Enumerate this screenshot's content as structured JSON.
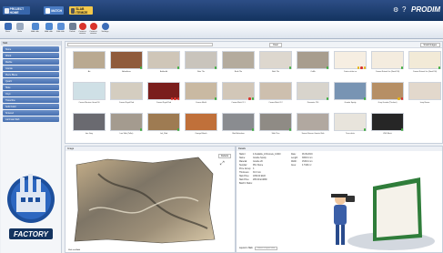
{
  "topbar": {
    "tabs": [
      {
        "label": "PROJECT HOME"
      },
      {
        "label": "MATCH"
      },
      {
        "label": "SLAB ITEMIZE"
      }
    ],
    "brand": "PRODIM",
    "icons": [
      "gear-icon",
      "question-icon"
    ]
  },
  "ribbon": {
    "buttons": [
      "Save",
      "Undo",
      "Add slab",
      "Add slab",
      "Edit slab",
      "Delete",
      "Connect camera",
      "Connect camera",
      "Settings"
    ]
  },
  "sidebar": {
    "header": "Slab",
    "items": [
      "Stone",
      "Wood",
      "Marble",
      "Granite",
      "Pierre Bleue",
      "Quartz",
      "Slate",
      "Onyx",
      "Travertine",
      "Solid Color",
      "Sintered",
      "Laminate Slab"
    ]
  },
  "grid": {
    "search_button": "Clear",
    "view_select": "Small Images",
    "tiles": [
      {
        "label": "Art"
      },
      {
        "label": "Arborifieso"
      },
      {
        "label": "Artifordid"
      },
      {
        "label": "Bats Tile"
      },
      {
        "label": "Bathi Tile"
      },
      {
        "label": "Bath Tile"
      },
      {
        "label": "CaMa"
      },
      {
        "label": "Cortes white ice"
      },
      {
        "label": "Cosmo Natural Ice (Small 90)"
      },
      {
        "label": "Cosmo Natural Ice (Small 90)"
      },
      {
        "label": "Cosmo Marinus Grand 90"
      },
      {
        "label": "Cosmo Royal Red"
      },
      {
        "label": "Cosmo Royal Red"
      },
      {
        "label": "Cosmo Marhl"
      },
      {
        "label": "Cosmo Marhl 1.1"
      },
      {
        "label": "Cosmo Marhl 1.2"
      },
      {
        "label": "Diamante 790"
      },
      {
        "label": "Granite Spotty"
      },
      {
        "label": "Gray Granite (Thickest)"
      },
      {
        "label": "Ivory Brown"
      },
      {
        "label": "Iron Grey"
      },
      {
        "label": "Iron Slab (Toller)"
      },
      {
        "label": "Lak_Slab"
      },
      {
        "label": "Orange Blanch"
      },
      {
        "label": "Slab Belvedere"
      },
      {
        "label": "Slab Tiles"
      },
      {
        "label": "Sunset Breeze Granite Slab"
      },
      {
        "label": "Terra white"
      },
      {
        "label": "ZHS Black"
      }
    ]
  },
  "preview": {
    "header": "Image",
    "button": "Defects",
    "caption": "Slab and Add"
  },
  "details": {
    "header": "Details",
    "rows": [
      {
        "k": "Slabnr:",
        "v": "4-Scalable_Z-Ronnele_13440"
      },
      {
        "k": "Name:",
        "v": "Granite Spotty"
      },
      {
        "k": "Material:",
        "v": "Granite 2K"
      },
      {
        "k": "Supplier:",
        "v": "Plim Stone"
      },
      {
        "k": "Price Group:",
        "v": "3"
      },
      {
        "k": "Thickness:",
        "v": "30.0 mm"
      },
      {
        "k": "Slab Price:",
        "v": "1050.00 EUR"
      },
      {
        "k": "Slab Price:",
        "v": "295.00 EUR/M²"
      },
      {
        "k": "Batch's Slabs:",
        "v": ""
      }
    ],
    "rows2": [
      {
        "k": "Date:",
        "v": "06.09.2019"
      },
      {
        "k": "Length:",
        "v": "3060.0 mm"
      },
      {
        "k": "Width:",
        "v": "1530.0 mm"
      },
      {
        "k": "Area:",
        "v": "4.7320 m²"
      }
    ],
    "footer_label": "Layout in Slab:",
    "footer_value": "Select a layout slab"
  },
  "logo": {
    "text": "FACTORY"
  },
  "colors": {
    "accent": "#1f4c8f",
    "status_green": "#3fae3f",
    "status_red": "#d9332b",
    "status_yellow": "#e7b316"
  }
}
